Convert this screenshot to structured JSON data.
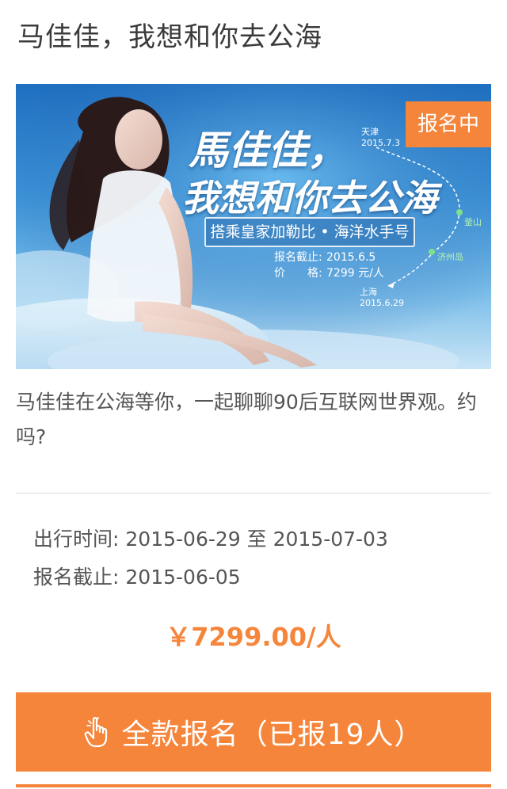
{
  "page_title": "马佳佳，我想和你去公海",
  "banner": {
    "status_badge": "报名中",
    "title_line1": "馬佳佳，",
    "title_line2": "我想和你去公海",
    "subtitle": "搭乘皇家加勒比 • 海洋水手号",
    "deadline_key": "报名截止:",
    "deadline_value": "2015.6.5",
    "price_key": "价　　格:",
    "price_value": "7299 元/人",
    "route": [
      {
        "city": "天津",
        "date": "2015.7.3"
      },
      {
        "city": "釜山",
        "date": ""
      },
      {
        "city": "济州岛",
        "date": ""
      },
      {
        "city": "上海",
        "date": "2015.6.29"
      }
    ]
  },
  "description": "马佳佳在公海等你，一起聊聊90后互联网世界观。约吗?",
  "details": {
    "travel_label": "出行时间:",
    "travel_value": "2015-06-29 至 2015-07-03",
    "deadline_label": "报名截止:",
    "deadline_value": "2015-06-05"
  },
  "price": "￥7299.00/人",
  "signup_button": {
    "label": "全款报名（已报19人）",
    "icon": "hand-pointer-icon"
  },
  "colors": {
    "accent": "#f5853a",
    "banner_blue": "#2f80cc",
    "text": "#555555"
  }
}
